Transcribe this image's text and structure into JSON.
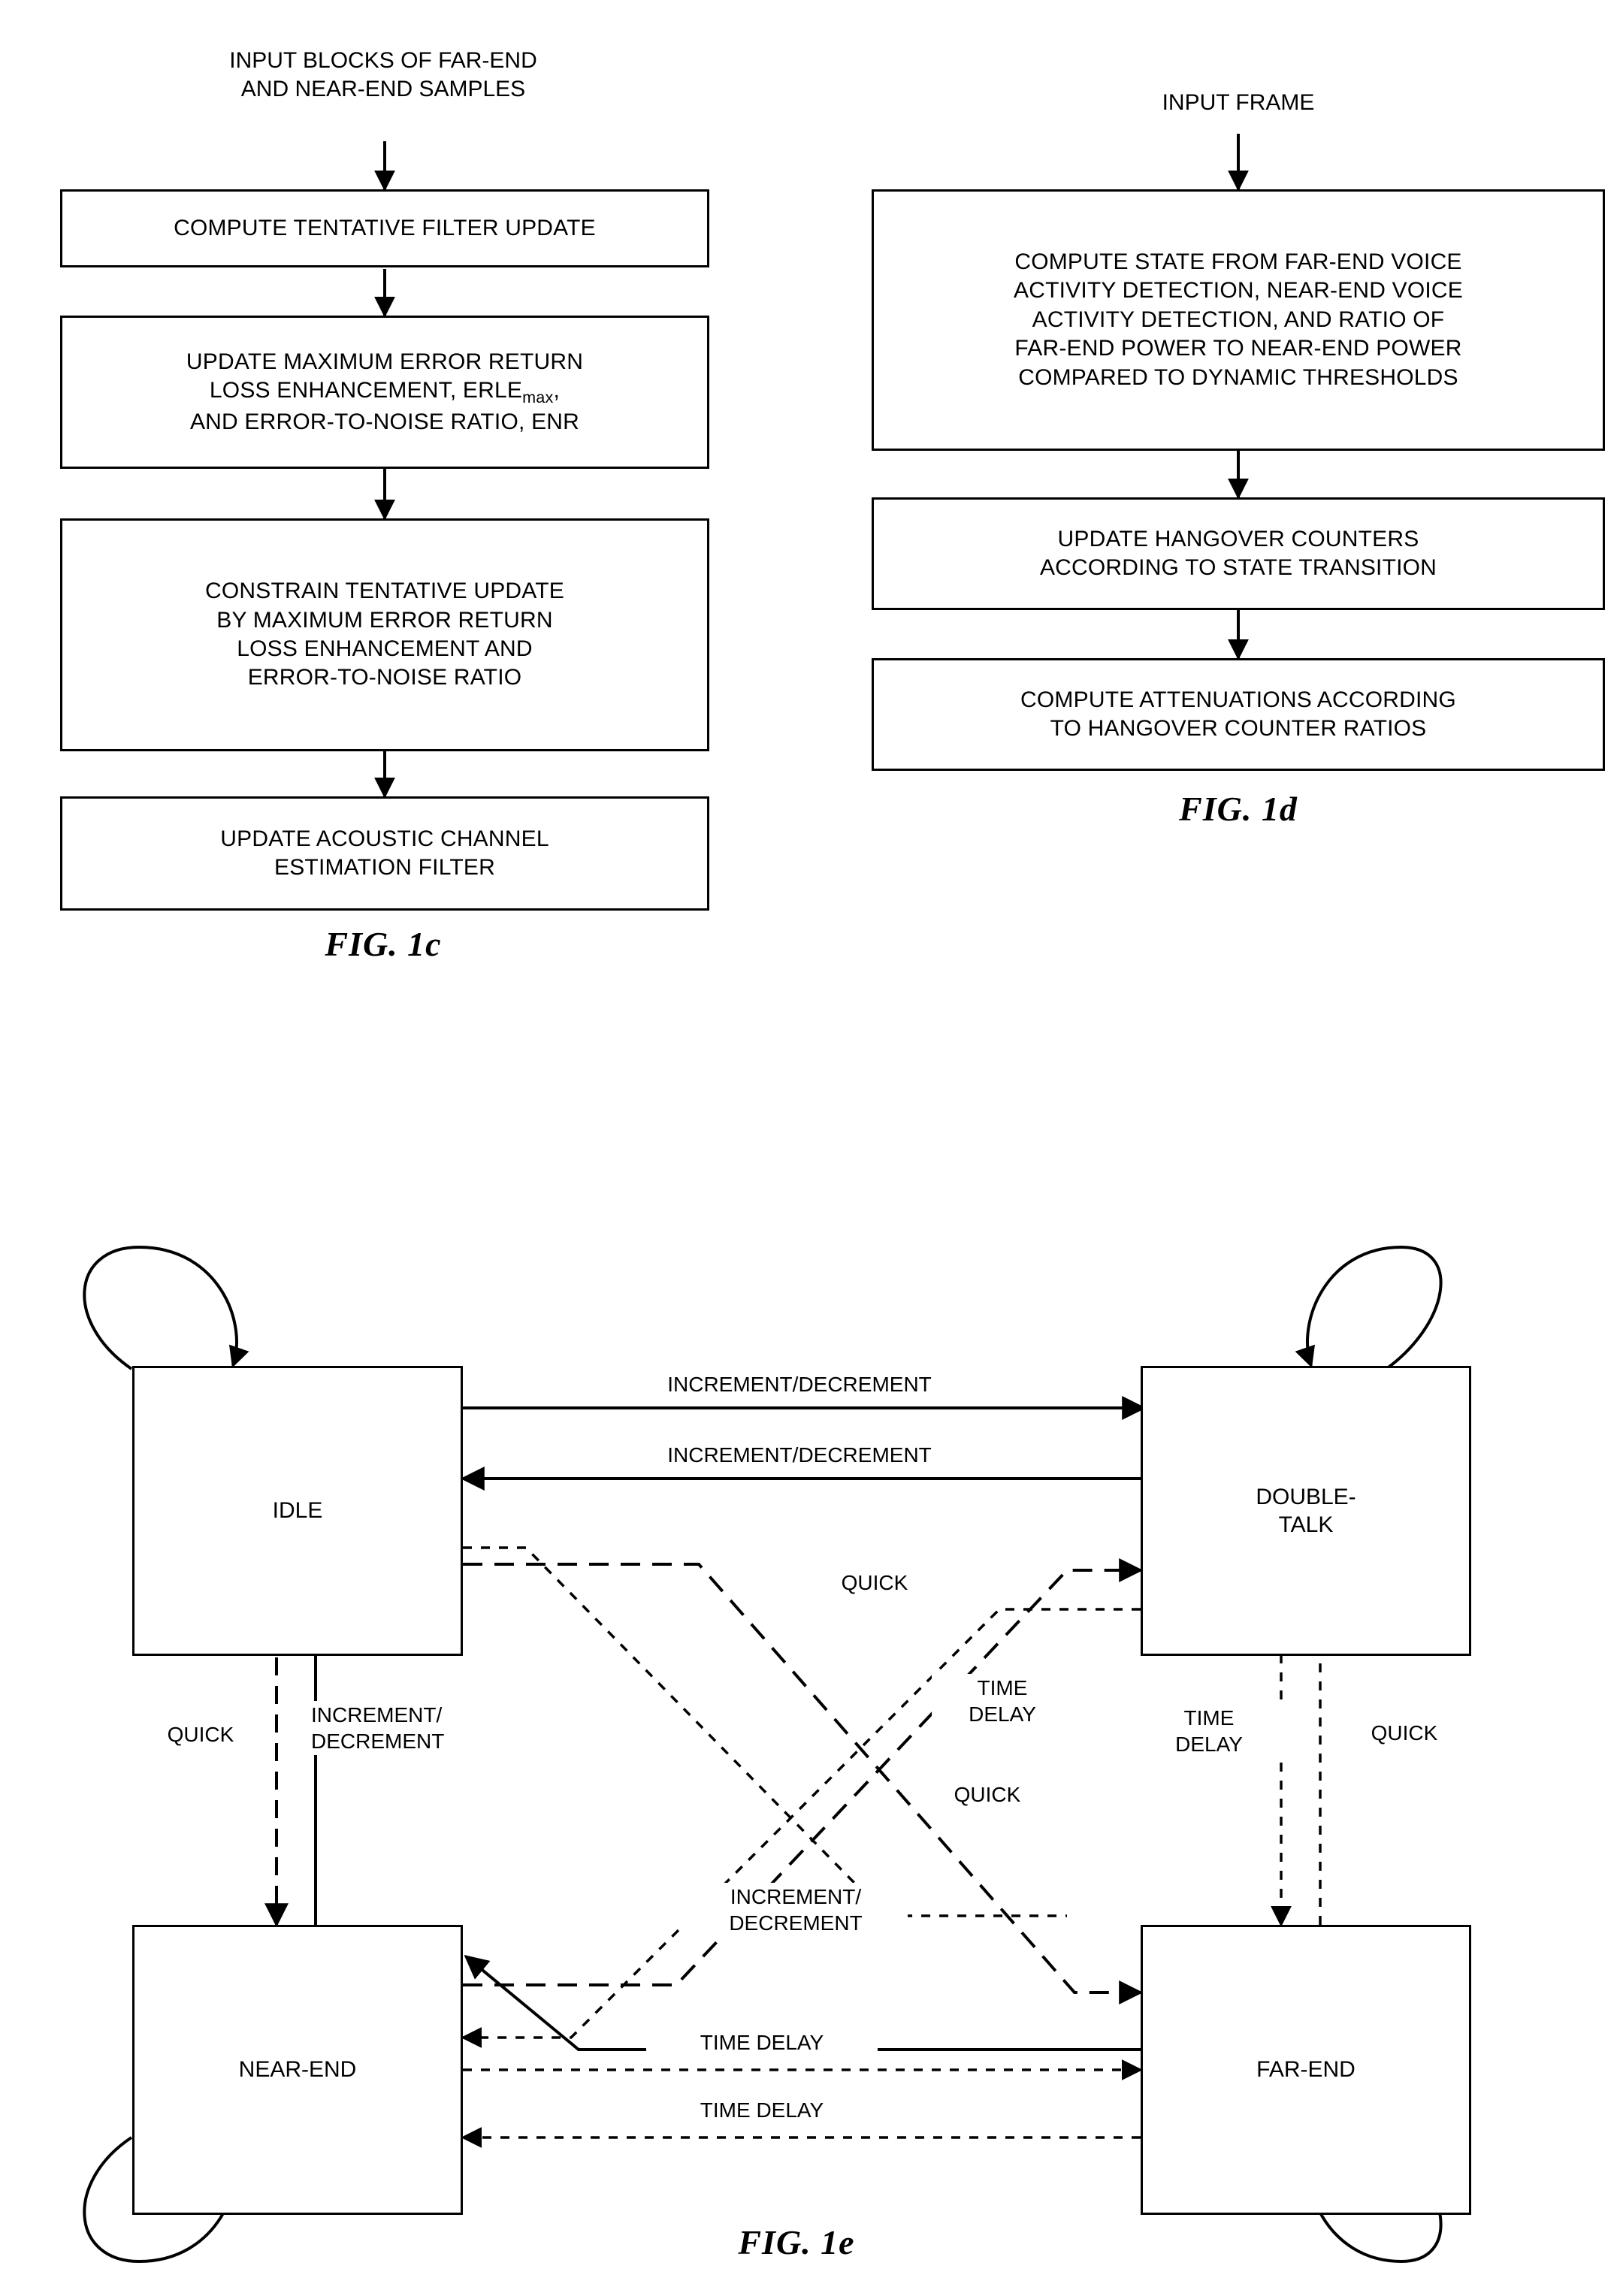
{
  "figure_1c": {
    "label": "FIG. 1c",
    "input_caption": "INPUT BLOCKS OF FAR-END\nAND NEAR-END SAMPLES",
    "boxes": [
      {
        "id": "compute-tentative-filter-update",
        "text": "COMPUTE TENTATIVE FILTER UPDATE"
      },
      {
        "id": "update-maximum-error-return-loss",
        "text_before": "UPDATE MAXIMUM ERROR RETURN\nLOSS ENHANCEMENT, ERLE",
        "subscript": "max",
        "text_after": ",\nAND ERROR-TO-NOISE RATIO, ENR"
      },
      {
        "id": "constrain-tentative-update",
        "text": "CONSTRAIN TENTATIVE UPDATE\nBY MAXIMUM ERROR RETURN\nLOSS ENHANCEMENT AND\nERROR-TO-NOISE RATIO"
      },
      {
        "id": "update-acoustic-channel-estimation-filter",
        "text": "UPDATE ACOUSTIC CHANNEL\nESTIMATION FILTER"
      }
    ]
  },
  "figure_1d": {
    "label": "FIG. 1d",
    "input_caption": "INPUT FRAME",
    "boxes": [
      {
        "id": "compute-state",
        "text": "COMPUTE STATE FROM FAR-END VOICE\nACTIVITY DETECTION, NEAR-END VOICE\nACTIVITY DETECTION, AND RATIO OF\nFAR-END POWER TO NEAR-END POWER\nCOMPARED TO DYNAMIC THRESHOLDS"
      },
      {
        "id": "update-hangover-counters",
        "text": "UPDATE HANGOVER COUNTERS\nACCORDING TO STATE TRANSITION"
      },
      {
        "id": "compute-attenuations",
        "text": "COMPUTE ATTENUATIONS ACCORDING\nTO HANGOVER COUNTER RATIOS"
      }
    ]
  },
  "figure_1e": {
    "label": "FIG. 1e",
    "states": [
      {
        "id": "idle",
        "text": "IDLE"
      },
      {
        "id": "double-talk",
        "text": "DOUBLE-\nTALK"
      },
      {
        "id": "near-end",
        "text": "NEAR-END"
      },
      {
        "id": "far-end",
        "text": "FAR-END"
      }
    ],
    "edge_labels": [
      {
        "id": "idle-to-doubletalk",
        "text": "INCREMENT/DECREMENT"
      },
      {
        "id": "doubletalk-to-idle",
        "text": "INCREMENT/DECREMENT"
      },
      {
        "id": "quick-upper",
        "text": "QUICK"
      },
      {
        "id": "time-delay-center",
        "text": "TIME\nDELAY"
      },
      {
        "id": "quick-center-right",
        "text": "QUICK"
      },
      {
        "id": "quick-left",
        "text": "QUICK"
      },
      {
        "id": "increment-decrement-left",
        "text": "INCREMENT/\nDECREMENT"
      },
      {
        "id": "increment-decrement-center",
        "text": "INCREMENT/\nDECREMENT"
      },
      {
        "id": "time-delay-right",
        "text": "TIME\nDELAY"
      },
      {
        "id": "quick-right",
        "text": "QUICK"
      },
      {
        "id": "time-delay-bottom-upper",
        "text": "TIME DELAY"
      },
      {
        "id": "time-delay-bottom-lower",
        "text": "TIME DELAY"
      }
    ]
  }
}
